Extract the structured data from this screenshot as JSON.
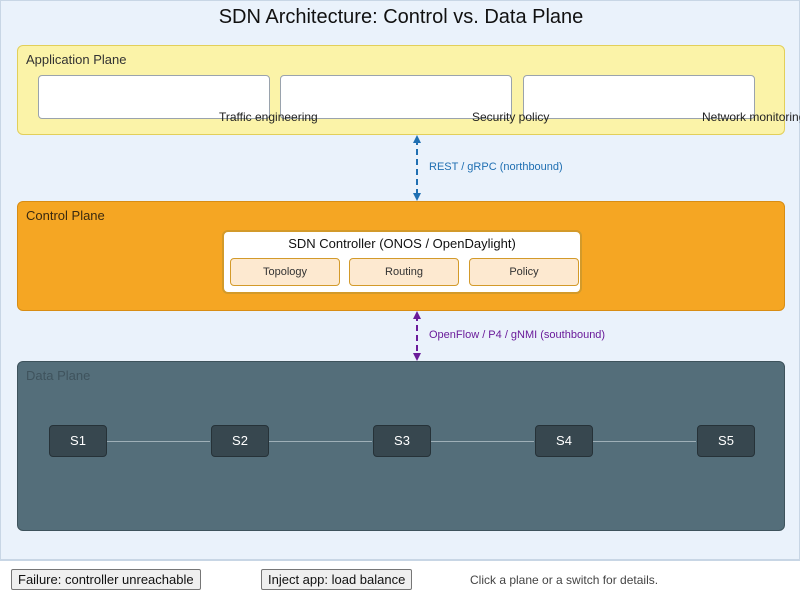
{
  "title": "SDN Architecture: Control vs. Data Plane",
  "application_plane": {
    "label": "Application Plane",
    "apps": [
      "Traffic engineering",
      "Security policy",
      "Network monitoring"
    ]
  },
  "northbound": {
    "label": "REST / gRPC (northbound)",
    "color": "#1f6fb2"
  },
  "control_plane": {
    "label": "Control Plane",
    "controller": {
      "title": "SDN Controller (ONOS / OpenDaylight)",
      "modules": [
        "Topology",
        "Routing",
        "Policy"
      ]
    }
  },
  "southbound": {
    "label": "OpenFlow / P4 / gNMI (southbound)",
    "color": "#6a1b9a"
  },
  "data_plane": {
    "label": "Data Plane",
    "switches": [
      "S1",
      "S2",
      "S3",
      "S4",
      "S5"
    ]
  },
  "controls": {
    "failure_button": "Failure: controller unreachable",
    "inject_button": "Inject app: load balance",
    "hint": "Click a plane or a switch for details."
  },
  "colors": {
    "application_plane": "#fbf3a8",
    "control_plane": "#f5a623",
    "data_plane": "#546e7a",
    "switch": "#37474f"
  }
}
